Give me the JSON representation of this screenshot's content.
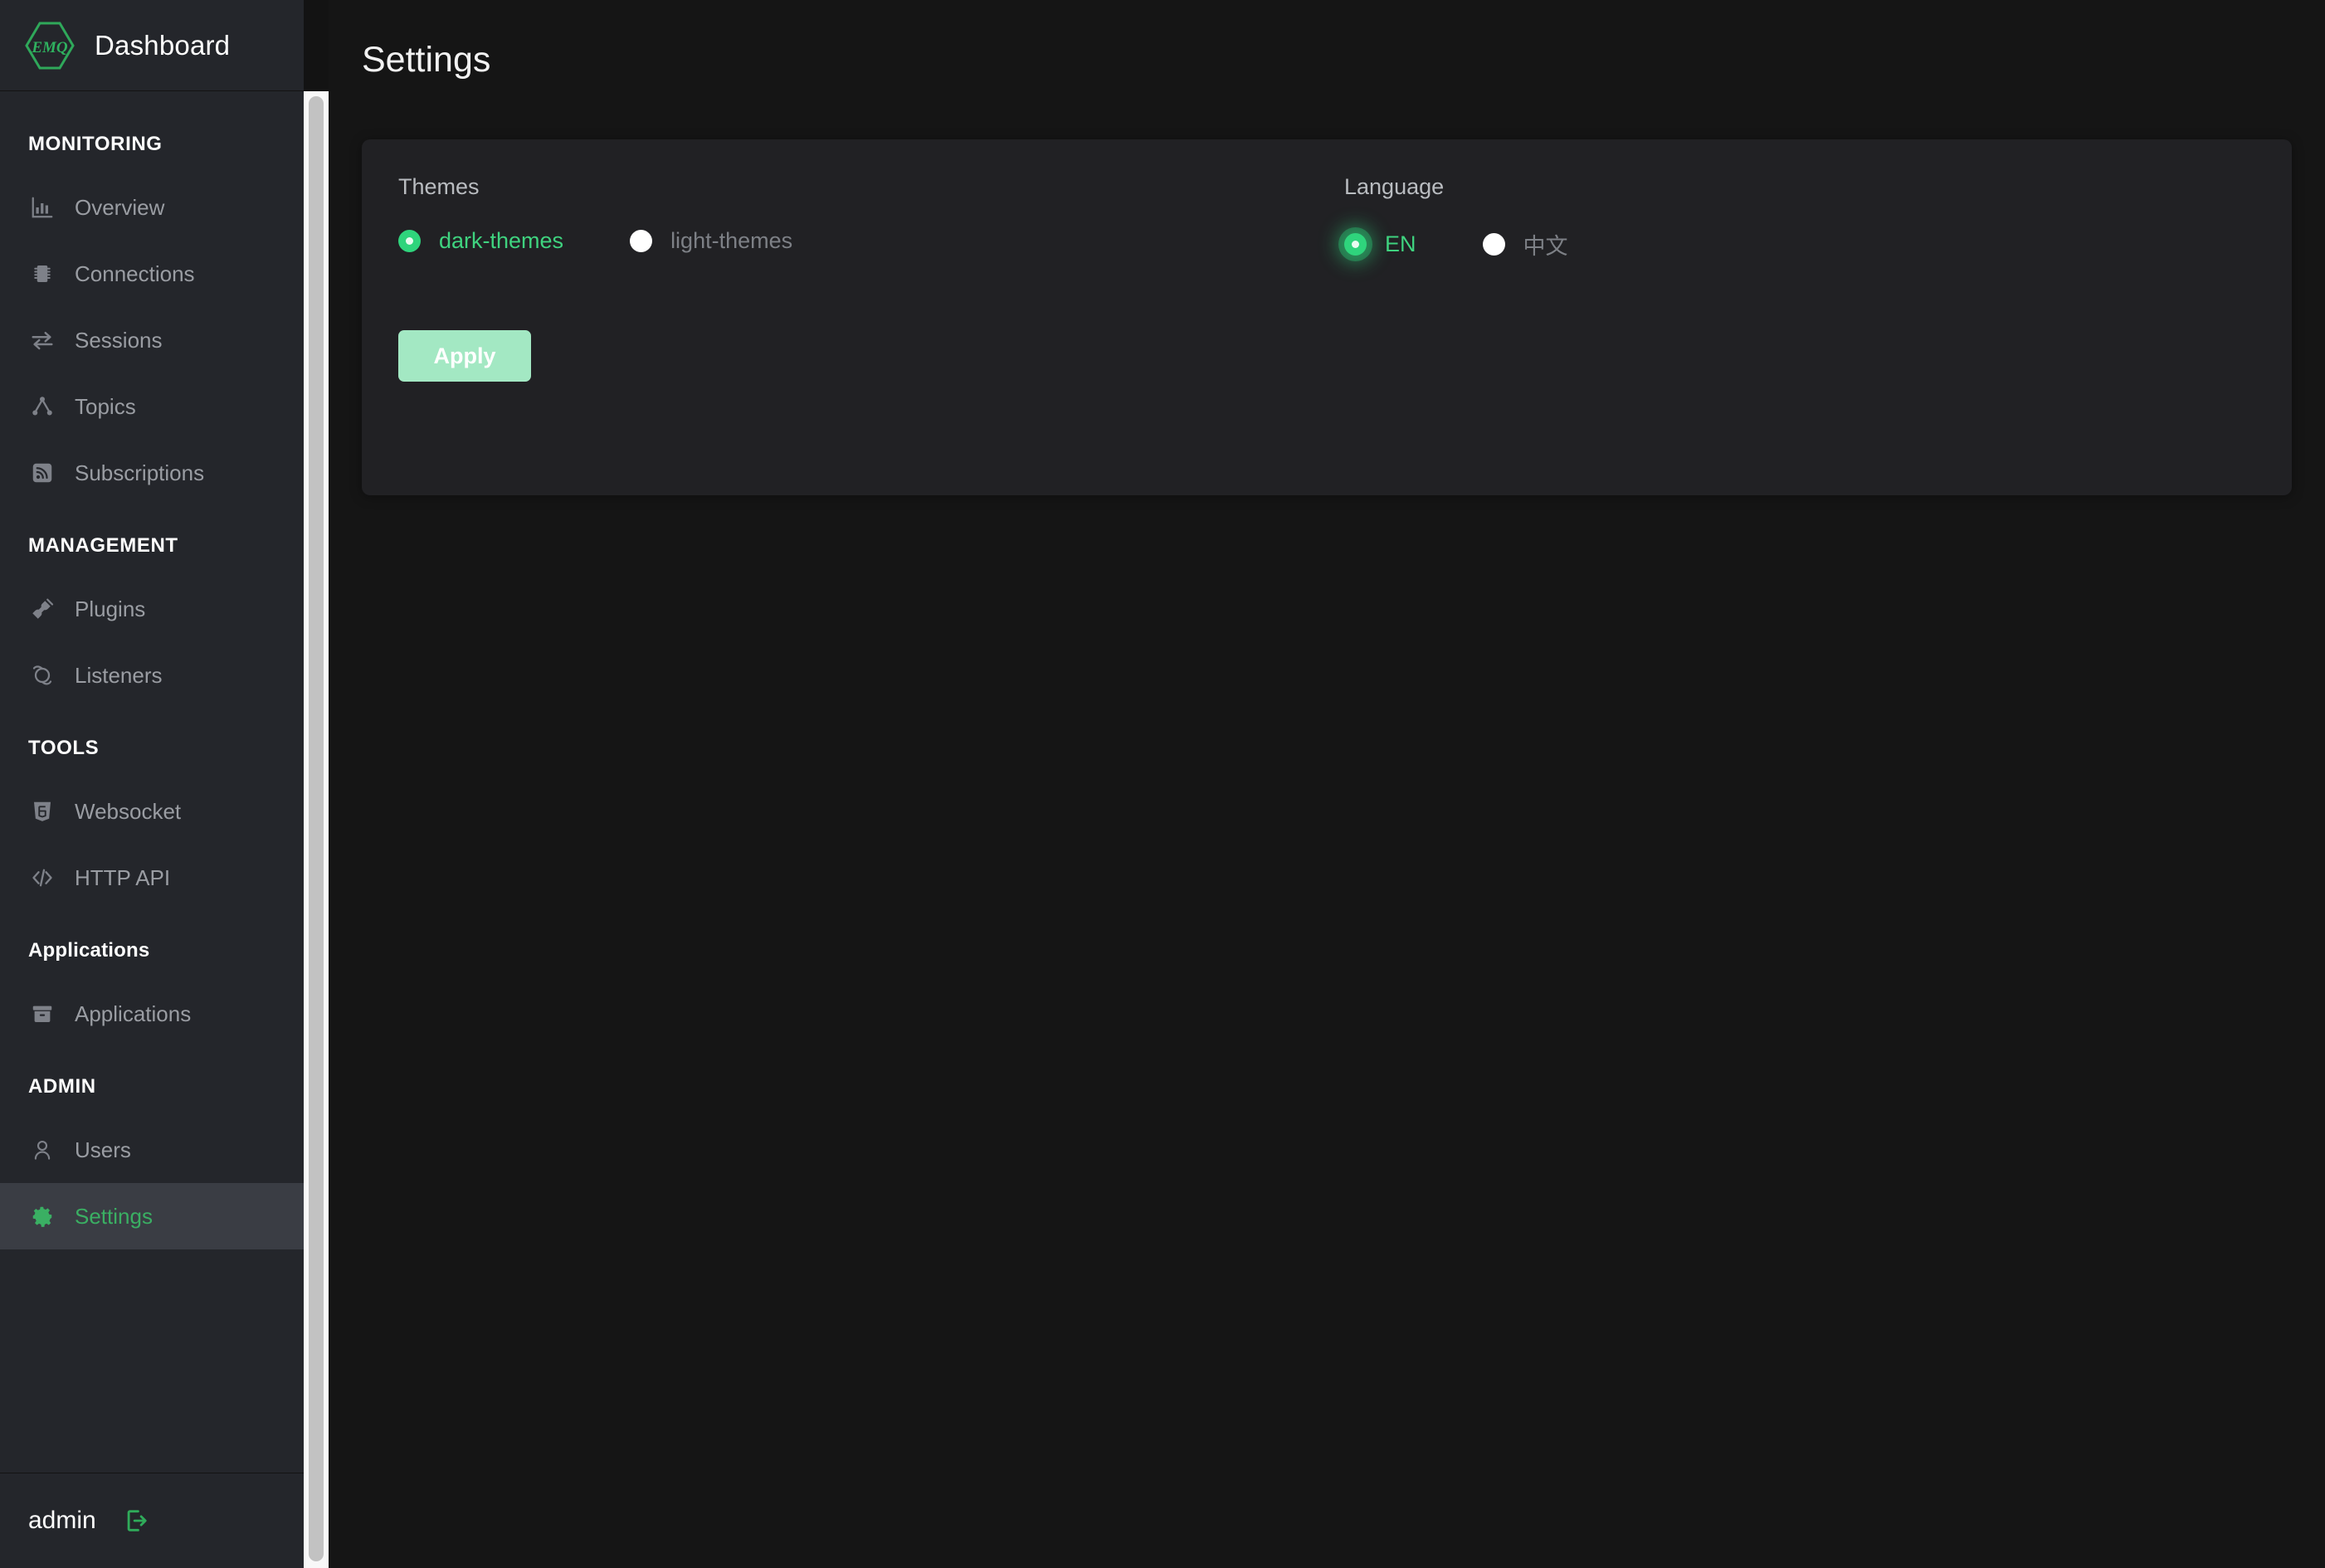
{
  "brand": {
    "logo_text": "EMQ",
    "logo_icon": "emq-hexagon-logo",
    "title": "Dashboard"
  },
  "sidebar": {
    "sections": [
      {
        "label": "MONITORING",
        "mixed_case": false,
        "items": [
          {
            "label": "Overview",
            "icon": "bar-chart-icon",
            "active": false
          },
          {
            "label": "Connections",
            "icon": "chip-icon",
            "active": false
          },
          {
            "label": "Sessions",
            "icon": "exchange-arrows-icon",
            "active": false
          },
          {
            "label": "Topics",
            "icon": "node-tree-icon",
            "active": false
          },
          {
            "label": "Subscriptions",
            "icon": "rss-feed-icon",
            "active": false
          }
        ]
      },
      {
        "label": "MANAGEMENT",
        "mixed_case": false,
        "items": [
          {
            "label": "Plugins",
            "icon": "plug-icon",
            "active": false
          },
          {
            "label": "Listeners",
            "icon": "listener-icon",
            "active": false
          }
        ]
      },
      {
        "label": "TOOLS",
        "mixed_case": false,
        "items": [
          {
            "label": "Websocket",
            "icon": "html5-shield-icon",
            "active": false
          },
          {
            "label": "HTTP API",
            "icon": "code-brackets-icon",
            "active": false
          }
        ]
      },
      {
        "label": "Applications",
        "mixed_case": true,
        "items": [
          {
            "label": "Applications",
            "icon": "archive-box-icon",
            "active": false
          }
        ]
      },
      {
        "label": "ADMIN",
        "mixed_case": false,
        "items": [
          {
            "label": "Users",
            "icon": "user-icon",
            "active": false
          },
          {
            "label": "Settings",
            "icon": "gear-icon",
            "active": true
          }
        ]
      }
    ],
    "user": {
      "name": "admin",
      "logout_icon": "logout-icon"
    }
  },
  "main": {
    "page_title": "Settings",
    "themes": {
      "label": "Themes",
      "options": [
        {
          "label": "dark-themes",
          "selected": true,
          "focused": false
        },
        {
          "label": "light-themes",
          "selected": false,
          "focused": false
        }
      ]
    },
    "language": {
      "label": "Language",
      "options": [
        {
          "label": "EN",
          "selected": true,
          "focused": true
        },
        {
          "label": "中文",
          "selected": false,
          "focused": false
        }
      ]
    },
    "apply_label": "Apply"
  },
  "colors": {
    "accent_green": "#2fd47c",
    "active_green": "#3aaf63",
    "apply_button": "#a3e8c3",
    "sidebar_bg": "#24262b",
    "page_bg": "#151515",
    "card_bg": "#212124"
  }
}
